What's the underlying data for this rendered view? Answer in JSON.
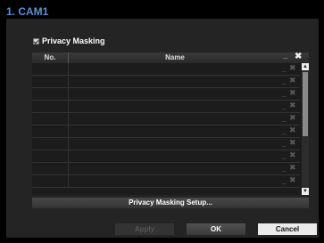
{
  "window": {
    "title": "1. CAM1"
  },
  "privacy": {
    "checkbox_label": "Privacy Masking",
    "checked": true
  },
  "table": {
    "col_no": "No.",
    "col_name": "Name",
    "header_dash": "_",
    "row_count": 10
  },
  "buttons": {
    "setup": "Privacy Masking Setup...",
    "apply": "Apply",
    "ok": "OK",
    "cancel": "Cancel"
  },
  "icons": {
    "delete_all": "close-icon",
    "row_delete": "close-icon",
    "scroll_up": "triangle-up-icon",
    "scroll_down": "triangle-down-icon"
  }
}
